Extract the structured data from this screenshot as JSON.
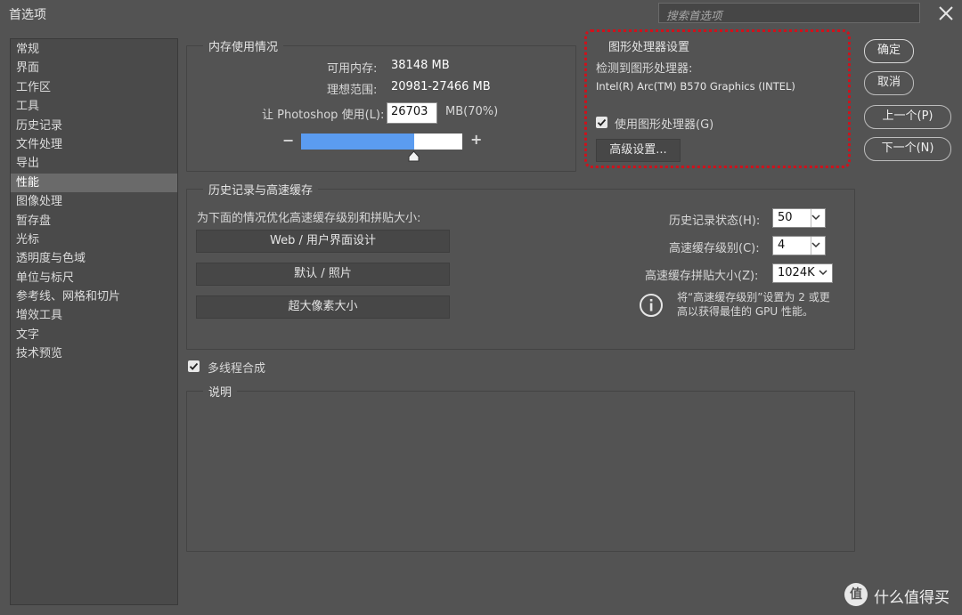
{
  "window": {
    "title": "首选项",
    "search_placeholder": "搜索首选项"
  },
  "sidebar": {
    "items": [
      {
        "label": "常规"
      },
      {
        "label": "界面"
      },
      {
        "label": "工作区"
      },
      {
        "label": "工具"
      },
      {
        "label": "历史记录"
      },
      {
        "label": "文件处理"
      },
      {
        "label": "导出"
      },
      {
        "label": "性能",
        "active": true
      },
      {
        "label": "图像处理"
      },
      {
        "label": "暂存盘"
      },
      {
        "label": "光标"
      },
      {
        "label": "透明度与色域"
      },
      {
        "label": "单位与标尺"
      },
      {
        "label": "参考线、网格和切片"
      },
      {
        "label": "增效工具"
      },
      {
        "label": "文字"
      },
      {
        "label": "技术预览"
      }
    ]
  },
  "memory": {
    "legend": "内存使用情况",
    "available_label": "可用内存:",
    "available_value": "38148 MB",
    "ideal_label": "理想范围:",
    "ideal_value": "20981-27466 MB",
    "use_label": "让 Photoshop 使用(L):",
    "use_value": "26703",
    "use_unit": "MB(70%)",
    "minus": "−",
    "plus": "+",
    "fill_fraction": 0.7
  },
  "gpu": {
    "legend": "图形处理器设置",
    "detected_label": "检测到图形处理器:",
    "gpu_name": "Intel(R) Arc(TM) B570 Graphics (INTEL)",
    "use_gpu_label": "使用图形处理器(G)",
    "use_gpu_checked": true,
    "advanced_button": "高级设置..."
  },
  "buttons": {
    "ok": "确定",
    "cancel": "取消",
    "prev": "上一个(P)",
    "next": "下一个(N)"
  },
  "cache": {
    "legend": "历史记录与高速缓存",
    "optimize_label": "为下面的情况优化高速缓存级别和拼贴大小:",
    "preset_web": "Web / 用户界面设计",
    "preset_default": "默认 / 照片",
    "preset_huge": "超大像素大小",
    "history_label": "历史记录状态(H):",
    "history_value": "50",
    "levels_label": "高速缓存级别(C):",
    "levels_value": "4",
    "tile_label": "高速缓存拼贴大小(Z):",
    "tile_value": "1024K",
    "hint_line1": "将“高速缓存级别”设置为 2 或更",
    "hint_line2": "高以获得最佳的 GPU 性能。"
  },
  "multithread": {
    "label": "多线程合成",
    "checked": true
  },
  "description": {
    "legend": "说明"
  },
  "watermark": {
    "text": "什么值得买",
    "badge": "值"
  },
  "colors": {
    "background": "#535353",
    "sidebar": "#4a4a4a",
    "selected": "#6a6a6a",
    "bar_fill": "#5b9cf0",
    "highlight": "#d0111b"
  }
}
